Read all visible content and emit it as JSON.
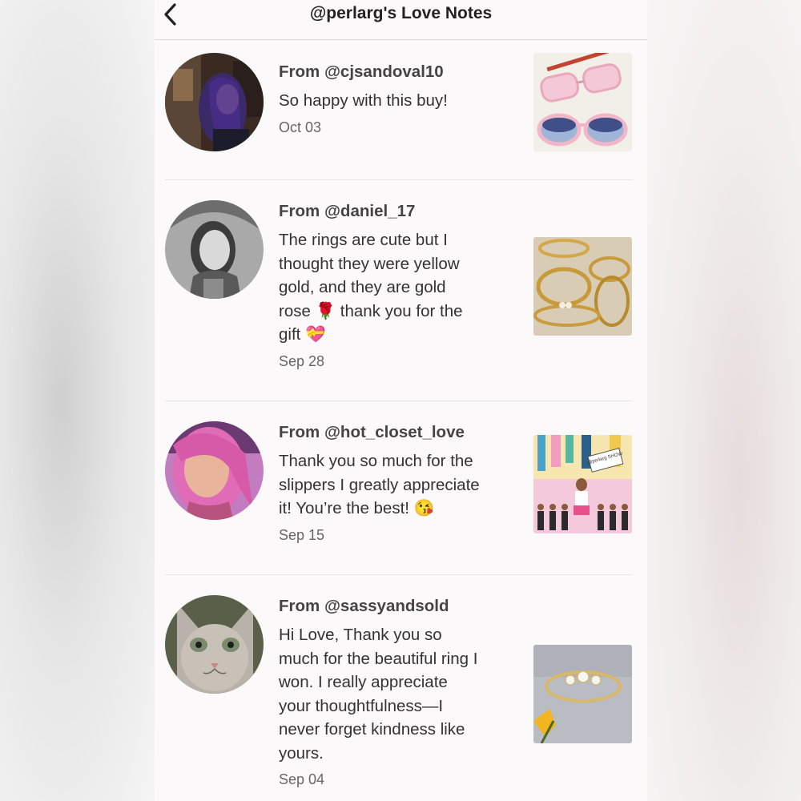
{
  "header": {
    "title": "@perlarg's Love Notes",
    "back_icon": "chevron-left-icon"
  },
  "notes": [
    {
      "from": "From @cjsandoval10",
      "message": "So happy with this buy!",
      "emoji": "",
      "date": "Oct 03",
      "avatar": "user-avatar-purple-hair",
      "thumbnail": "sunglasses-product"
    },
    {
      "from": "From @daniel_17",
      "message": "The rings are cute but I\nthought they were yellow\ngold, and they are gold\nrose 🌹 thank you for the\ngift 💝",
      "date": "Sep 28",
      "avatar": "user-avatar-grayscale",
      "thumbnail": "gold-rings-product"
    },
    {
      "from": "From @hot_closet_love",
      "message": "Thank you so much for the\nslippers I greatly appreciate\nit! You’re the best! 😘",
      "date": "Sep 15",
      "avatar": "user-avatar-pink-hair",
      "thumbnail": "show-illustration",
      "thumbnail_sign": "@perlarg SHOW"
    },
    {
      "from": "From @sassyandsold",
      "message": "Hi Love, Thank you so\nmuch for the beautiful ring I\nwon. I really appreciate\nyour thoughtfulness—I\nnever forget kindness like\nyours.",
      "date": "Sep 04",
      "avatar": "user-avatar-cat",
      "thumbnail": "diamond-ring-product"
    }
  ],
  "colors": {
    "background": "#fbf9f9",
    "text_primary": "#333333",
    "text_secondary": "#666666",
    "divider": "#e6e3e3"
  }
}
